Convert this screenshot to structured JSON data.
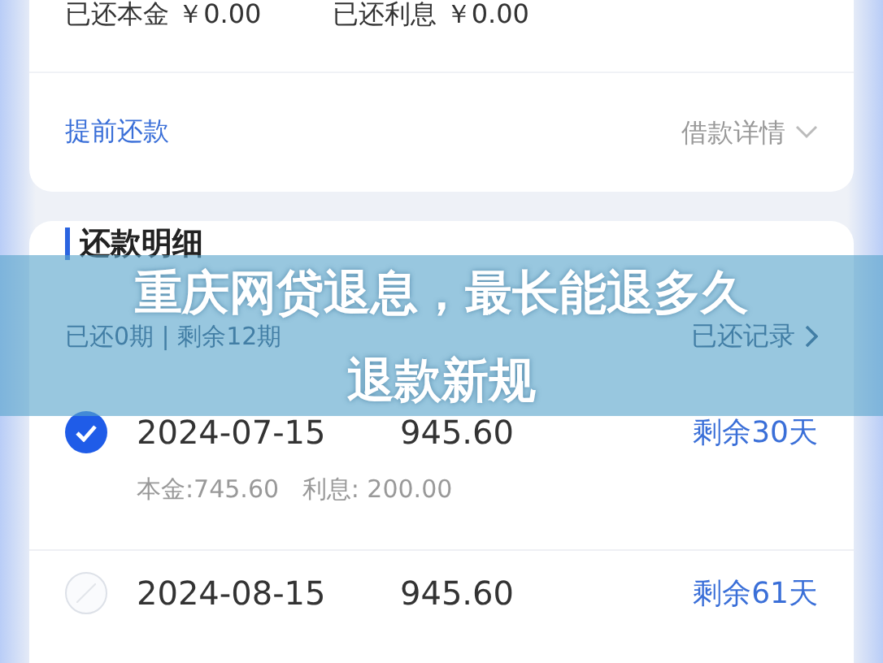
{
  "summary_card": {
    "paid_principal": {
      "label": "已还本金",
      "value": "￥0.00"
    },
    "paid_interest": {
      "label": "已还利息",
      "value": "￥0.00"
    },
    "early_repay_link": "提前还款",
    "loan_details_link": "借款详情"
  },
  "repayment_card": {
    "title": "还款明细",
    "progress": "已还0期 | 剩余12期",
    "history_link": "已还记录",
    "installments": [
      {
        "date": "2024-07-15",
        "amount": "945.60",
        "remaining": "剩余30天",
        "selected": true,
        "breakdown": "本金:745.60   利息: 200.00"
      },
      {
        "date": "2024-08-15",
        "amount": "945.60",
        "remaining": "剩余61天",
        "selected": false
      }
    ]
  },
  "banner": {
    "lines": [
      "重庆网贷退息，最长能退多久",
      "退款新规"
    ]
  }
}
